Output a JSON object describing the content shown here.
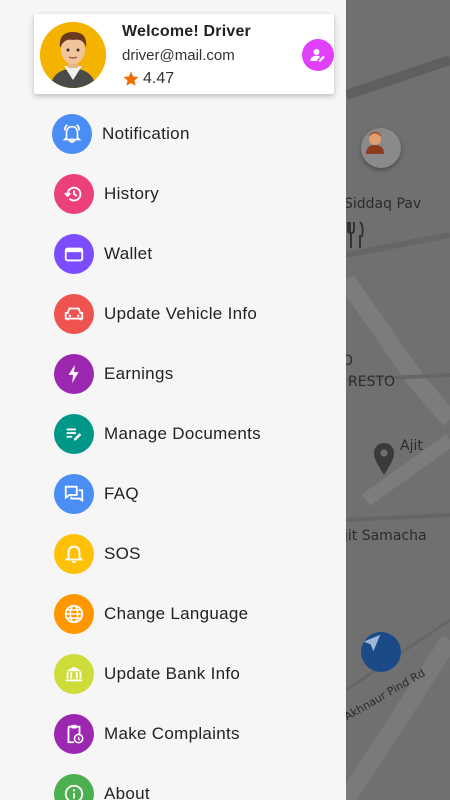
{
  "header": {
    "welcome": "Welcome! Driver",
    "email": "driver@mail.com",
    "rating": "4.47",
    "rating_color": "#ef6c00",
    "edit_color": "#e040fb"
  },
  "menu": {
    "items": [
      {
        "label": "Notification",
        "icon": "bell-ring-icon",
        "color": "#4a8df5"
      },
      {
        "label": "History",
        "icon": "history-icon",
        "color": "#ec407a"
      },
      {
        "label": "Wallet",
        "icon": "wallet-icon",
        "color": "#7c4dff"
      },
      {
        "label": "Update Vehicle Info",
        "icon": "car-icon",
        "color": "#ef5350"
      },
      {
        "label": "Earnings",
        "icon": "lightning-icon",
        "color": "#9c27b0"
      },
      {
        "label": "Manage Documents",
        "icon": "document-edit-icon",
        "color": "#009688"
      },
      {
        "label": "FAQ",
        "icon": "chat-bubbles-icon",
        "color": "#4a8df5"
      },
      {
        "label": "SOS",
        "icon": "bell-icon",
        "color": "#ffc107"
      },
      {
        "label": "Change Language",
        "icon": "globe-icon",
        "color": "#ff9800"
      },
      {
        "label": "Update Bank Info",
        "icon": "bank-icon",
        "color": "#cddc39"
      },
      {
        "label": "Make Complaints",
        "icon": "clipboard-clock-icon",
        "color": "#9c27b0"
      },
      {
        "label": "About",
        "icon": "info-icon",
        "color": "#4caf50"
      }
    ]
  },
  "map": {
    "labels": [
      "Siddaq Pav",
      "O",
      "RESTO",
      "Ajit",
      "jit Samacha",
      "Akhnaur Pind Rd"
    ]
  }
}
